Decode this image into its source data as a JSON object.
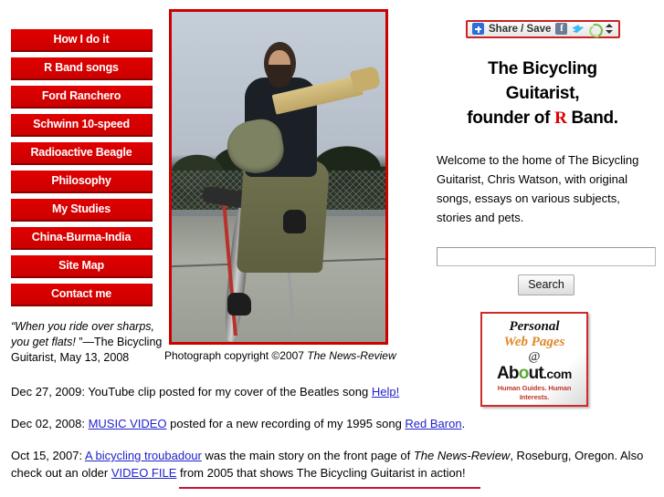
{
  "nav": {
    "items": [
      {
        "label": "How I do it"
      },
      {
        "label": "R Band songs"
      },
      {
        "label": "Ford Ranchero"
      },
      {
        "label": "Schwinn 10-speed"
      },
      {
        "label": "Radioactive Beagle"
      },
      {
        "label": "Philosophy"
      },
      {
        "label": "My Studies"
      },
      {
        "label": "China-Burma-India"
      },
      {
        "label": "Site Map"
      },
      {
        "label": "Contact me"
      }
    ]
  },
  "quote": {
    "text": "“When you ride over sharps, you get flats!",
    "attribution": "”—The Bicycling Guitarist, May 13, 2008"
  },
  "photo": {
    "alt": "The Bicycling Guitarist playing a Fender guitar while seated on a bicycle",
    "caption_prefix": "Photograph copyright ©2007 ",
    "caption_source": "The News-Review"
  },
  "share": {
    "label": "Share / Save",
    "icons": [
      "addthis-plus-icon",
      "facebook-icon",
      "twitter-icon",
      "share-refresh-icon",
      "up-down-arrows-icon"
    ],
    "border_color": "#cc2222"
  },
  "title": {
    "line1": "The Bicycling",
    "line2": "Guitarist,",
    "line3_pre": "founder of ",
    "line3_r": "R",
    "line3_post": " Band."
  },
  "welcome": {
    "text": "Welcome to the home of The Bicycling Guitarist, Chris Watson, with original songs, essays on various subjects, stories and pets."
  },
  "search": {
    "value": "",
    "placeholder": "",
    "button_label": "Search"
  },
  "about_badge": {
    "personal": "Personal",
    "web_pages": "Web Pages",
    "at": "@",
    "logo_a": "Ab",
    "logo_o": "o",
    "logo_ut": "ut",
    "logo_com": ".com",
    "tagline": "Human Guides. Human Interests.",
    "orange": "#e08828",
    "green": "#5aa832",
    "red": "#c0392b"
  },
  "news": [
    {
      "date": "Dec 27, 2009: ",
      "parts": [
        {
          "t": "text",
          "v": "YouTube clip posted for my cover of the Beatles song "
        },
        {
          "t": "link",
          "v": "Help!"
        }
      ]
    },
    {
      "date": "Dec 02, 2008: ",
      "parts": [
        {
          "t": "link",
          "v": "MUSIC VIDEO"
        },
        {
          "t": "text",
          "v": " posted for a new recording of my 1995 song "
        },
        {
          "t": "link",
          "v": "Red Baron"
        },
        {
          "t": "text",
          "v": "."
        }
      ]
    },
    {
      "date": "Oct 15, 2007: ",
      "parts": [
        {
          "t": "link",
          "v": "A bicycling troubadour"
        },
        {
          "t": "text",
          "v": " was the main story on the front page of "
        },
        {
          "t": "italic",
          "v": "The News-Review"
        },
        {
          "t": "text",
          "v": ", Roseburg, Oregon. Also check out an older "
        },
        {
          "t": "link",
          "v": "VIDEO FILE"
        },
        {
          "t": "text",
          "v": " from 2005 that shows The Bicycling Guitarist in action!"
        }
      ]
    }
  ],
  "colors": {
    "nav_red": "#dd0000",
    "nav_shadow": "#8d0000",
    "link_blue": "#2222cc",
    "rule_red": "#cc1133",
    "title_r_red": "#e00000"
  }
}
